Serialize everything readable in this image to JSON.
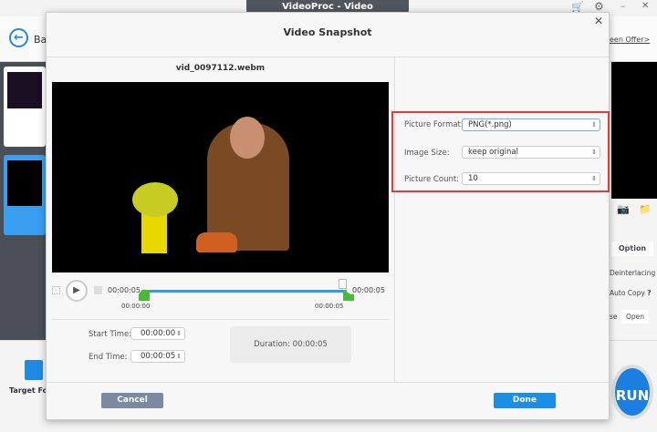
{
  "app": {
    "title": "VideoProc - Video",
    "back_label": "Ba",
    "offer_link": "een Offer>",
    "target_format": "Target For",
    "run_label": "RUN",
    "option_label": "Option",
    "deinterlacing": "Deinterlacing",
    "auto_copy": "Auto Copy",
    "auto_copy_help": "?",
    "browse_label": "se",
    "open_label": "Open"
  },
  "dialog": {
    "title": "Video Snapshot",
    "filename": "vid_0097112.webm",
    "player": {
      "current_time": "00:00:05",
      "end_time_label": "00:00:05",
      "range_start": "00:00:00",
      "range_end": "00:00:05"
    },
    "start_time_label": "Start Time:",
    "start_time": "00:00:00",
    "end_time_label": "End Time:",
    "end_time": "00:00:05",
    "duration_label": "Duration:",
    "duration": "00:00:05",
    "settings": {
      "picture_format_label": "Picture Format:",
      "picture_format": "PNG(*.png)",
      "image_size_label": "Image Size:",
      "image_size": "keep original",
      "picture_count_label": "Picture Count:",
      "picture_count": "10"
    },
    "cancel_label": "Cancel",
    "done_label": "Done"
  },
  "colors": {
    "accent": "#1a8fe8",
    "highlight": "#e83a3a",
    "cancel": "#7c89a3"
  }
}
